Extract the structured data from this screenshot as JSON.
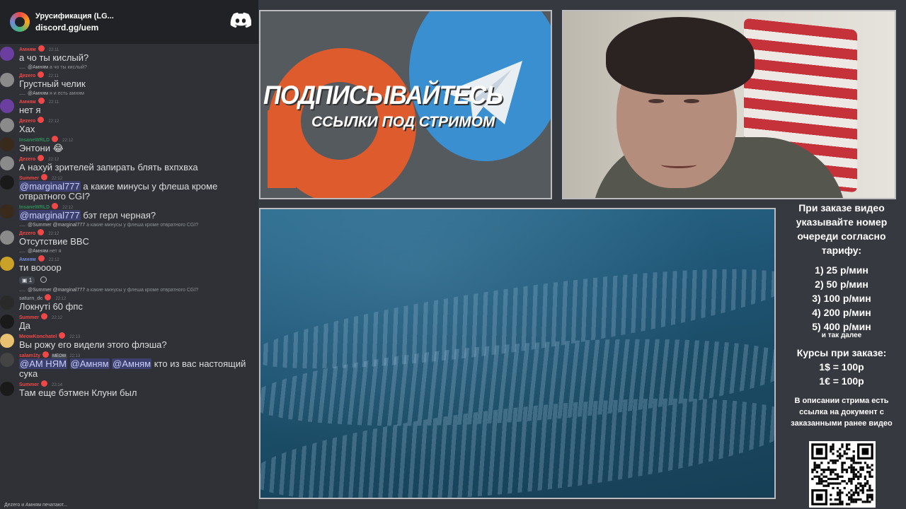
{
  "server": {
    "name": "Урусификация (LG...",
    "invite": "discord.gg/uem"
  },
  "messages": [
    {
      "reply": "",
      "reply_user": "",
      "user": "Амням",
      "user_color": "#f04747",
      "time": "22:11",
      "text": "а чо ты кислый?",
      "avatar_color": "#6b3fa0"
    },
    {
      "reply": "а чо ты кислый?",
      "reply_user": "@Амням",
      "user": "Дezero",
      "user_color": "#f04747",
      "time": "22:11",
      "text": "Грустный челик",
      "avatar_color": "#8a8a8a"
    },
    {
      "reply": "я и есть амням",
      "reply_user": "@Амням",
      "user": "Амням",
      "user_color": "#f04747",
      "time": "22:11",
      "text": "нет я",
      "avatar_color": "#6b3fa0"
    },
    {
      "reply": "",
      "reply_user": "",
      "user": "Дezero",
      "user_color": "#f04747",
      "time": "22:12",
      "text": "Хах",
      "avatar_color": "#8a8a8a"
    },
    {
      "reply": "",
      "reply_user": "",
      "user": "InsaneWRLD",
      "user_color": "#2e8b57",
      "time": "22:12",
      "text": "Энтони 😂",
      "avatar_color": "#3a2a1c"
    },
    {
      "reply": "",
      "reply_user": "",
      "user": "Дezero",
      "user_color": "#f04747",
      "time": "22:12",
      "text": "А нахуй зрителей запирать блять вхпхвха",
      "avatar_color": "#8a8a8a"
    },
    {
      "reply": "",
      "reply_user": "",
      "user": "Summer",
      "user_color": "#f04747",
      "time": "22:12",
      "text_parts": [
        {
          "mention": "@marginal777"
        },
        {
          "plain": " а какие минусы у флеша кроме отвратного CGI?"
        }
      ],
      "avatar_color": "#1a1a1a"
    },
    {
      "reply": "",
      "reply_user": "",
      "user": "InsaneWRLD",
      "user_color": "#2e8b57",
      "time": "22:12",
      "text_parts": [
        {
          "mention": "@marginal777"
        },
        {
          "plain": " бэт герл черная?"
        }
      ],
      "avatar_color": "#3a2a1c"
    },
    {
      "reply": "а какие минусы у флеша кроме отвратного CGI?",
      "reply_user": "@Summer @marginal777",
      "user": "Дezero",
      "user_color": "#f04747",
      "time": "22:12",
      "text": "Отсутствие BBC",
      "avatar_color": "#8a8a8a"
    },
    {
      "reply": "нет я",
      "reply_user": "@Амням",
      "user": "Амням",
      "user_color": "#7289da",
      "time": "22:12",
      "text": "ти воооор",
      "avatar_color": "#c9a227",
      "reaction": "1"
    },
    {
      "reply": "а какие минусы у флеша кроме отвратного CGI?",
      "reply_user": "@Summer @marginal777",
      "user": "saturn_dc",
      "user_color": "#8e9297",
      "time": "22:12",
      "text": "Локнуті 60 фпс",
      "avatar_color": "#2a2a2a"
    },
    {
      "reply": "",
      "reply_user": "",
      "user": "Summer",
      "user_color": "#f04747",
      "time": "22:12",
      "text": "Да",
      "avatar_color": "#1a1a1a"
    },
    {
      "reply": "",
      "reply_user": "",
      "user": "MeowKonchatel",
      "user_color": "#f04747",
      "time": "22:13",
      "text": "Вы рожу его видели этого флэша?",
      "avatar_color": "#e8c270"
    },
    {
      "reply": "",
      "reply_user": "",
      "user": "salam1ty",
      "user_color": "#f04747",
      "time": "22:13",
      "tag": "MEOW",
      "text_parts": [
        {
          "mention": "@АМ НЯМ"
        },
        {
          "plain": " "
        },
        {
          "mention": "@Амням"
        },
        {
          "plain": " "
        },
        {
          "mention": "@Амням"
        },
        {
          "plain": " кто из вас настоящий сука"
        }
      ],
      "avatar_color": "#444"
    },
    {
      "reply": "",
      "reply_user": "",
      "user": "Summer",
      "user_color": "#f04747",
      "time": "22:14",
      "text": "Там еще бэтмен Клуни был",
      "avatar_color": "#1a1a1a"
    }
  ],
  "typing": "Дezero и Амням печатают...",
  "promo": {
    "title": "ПОДПИСЫВАЙТЕСЬ",
    "subtitle": "ССЫЛКИ ПОД СТРИМОМ"
  },
  "info": {
    "order_note": "При заказе видео указывайте номер очереди согласно тарифу:",
    "rates": [
      "1) 25 р/мин",
      "2) 50 р/мин",
      "3) 100 р/мин",
      "4) 200 р/мин",
      "5) 400 р/мин"
    ],
    "etc": "и так далее",
    "courses_title": "Курсы при заказе:",
    "courses": [
      "1$ = 100р",
      "1€ = 100р"
    ],
    "desc": "В описании стрима есть ссылка на документ с заказанными ранее видео"
  },
  "colors": {
    "chat_bg": "#2f3136",
    "header_bg": "#202225",
    "page_bg": "#36393f",
    "patreon_orange": "#dd5b2d",
    "telegram_blue": "#3a8fd0"
  }
}
